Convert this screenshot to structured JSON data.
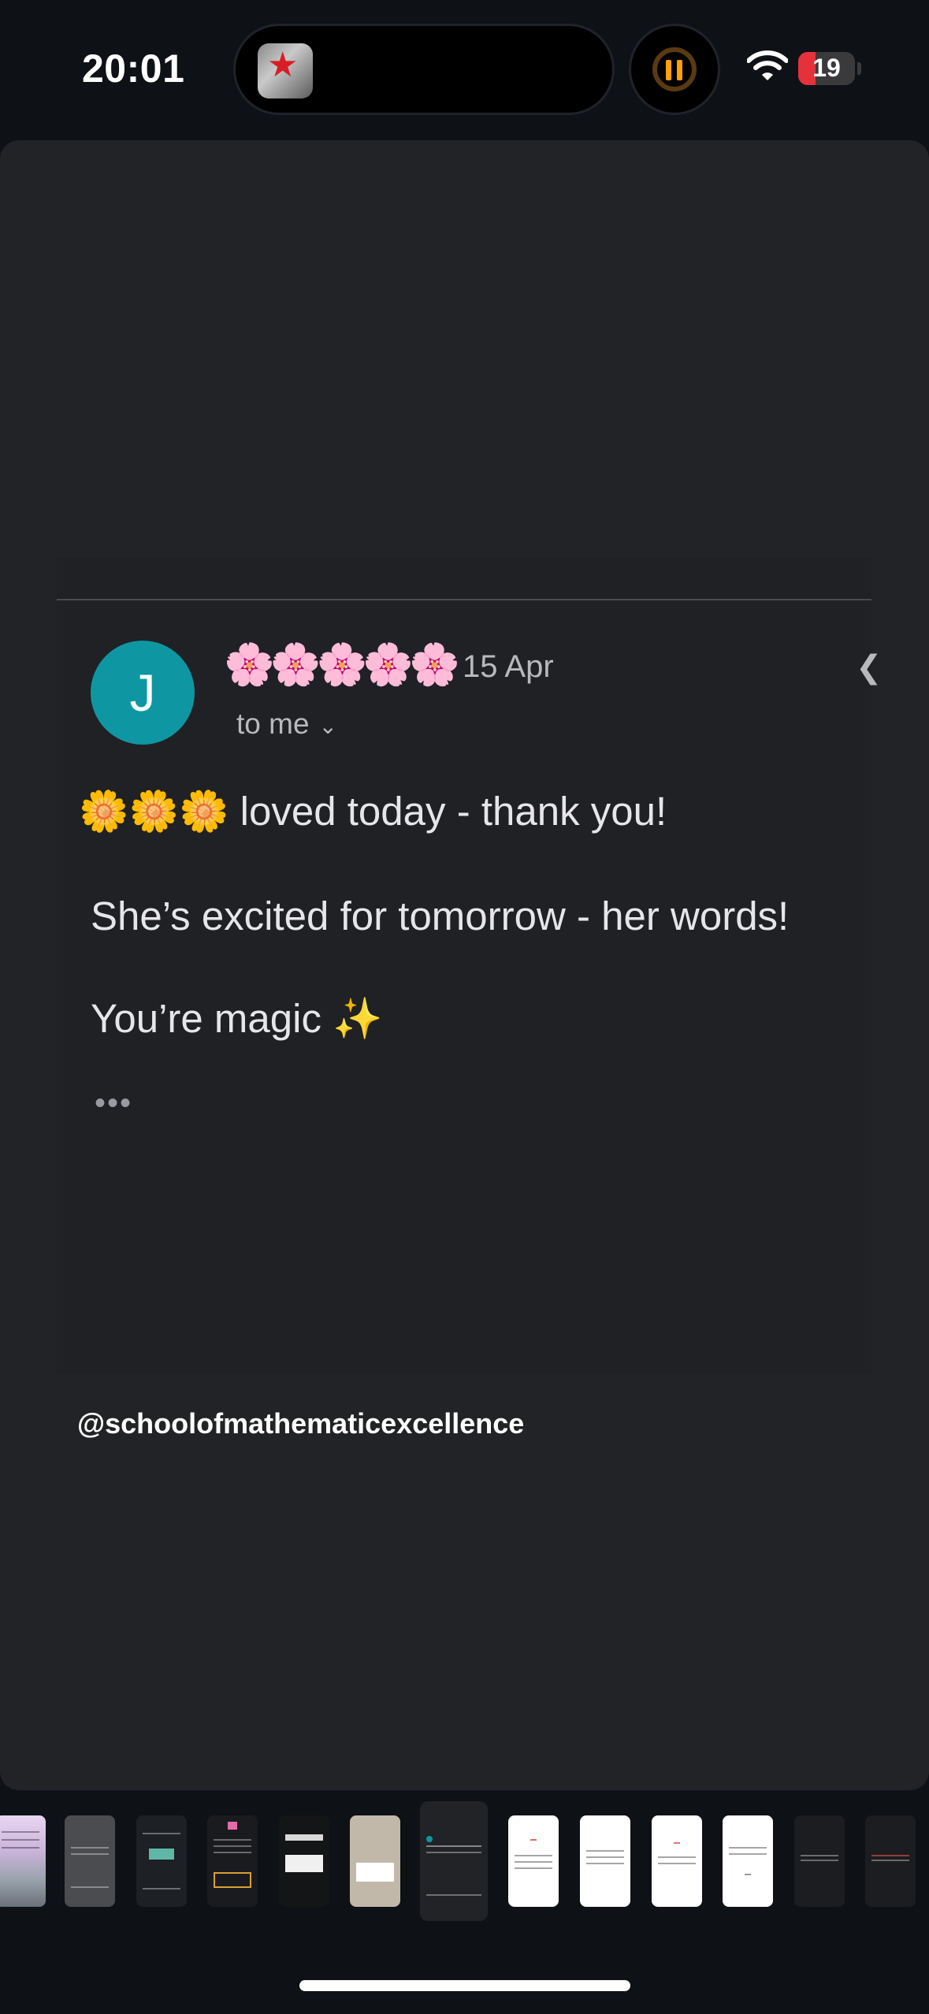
{
  "status_bar": {
    "time": "20:01",
    "battery_level": "19",
    "battery_fraction": 0.19,
    "icons": [
      "now-playing-thumbnail",
      "pause-icon",
      "wifi-icon",
      "battery-icon"
    ]
  },
  "email": {
    "avatar_initial": "J",
    "sender": "🌸🌸🌸🌸🌸",
    "date": "15 Apr",
    "recipient": "to me",
    "lines": [
      "🌼🌼🌼 loved today - thank you!",
      "She’s excited for tomorrow - her words!",
      "You’re magic ✨"
    ],
    "ellipsis": "•••",
    "avatar_color": "#0e97a3"
  },
  "handle": "@schoolofmathematicexcellence",
  "thumbnail_count": 13,
  "selected_thumbnail_index": 6
}
